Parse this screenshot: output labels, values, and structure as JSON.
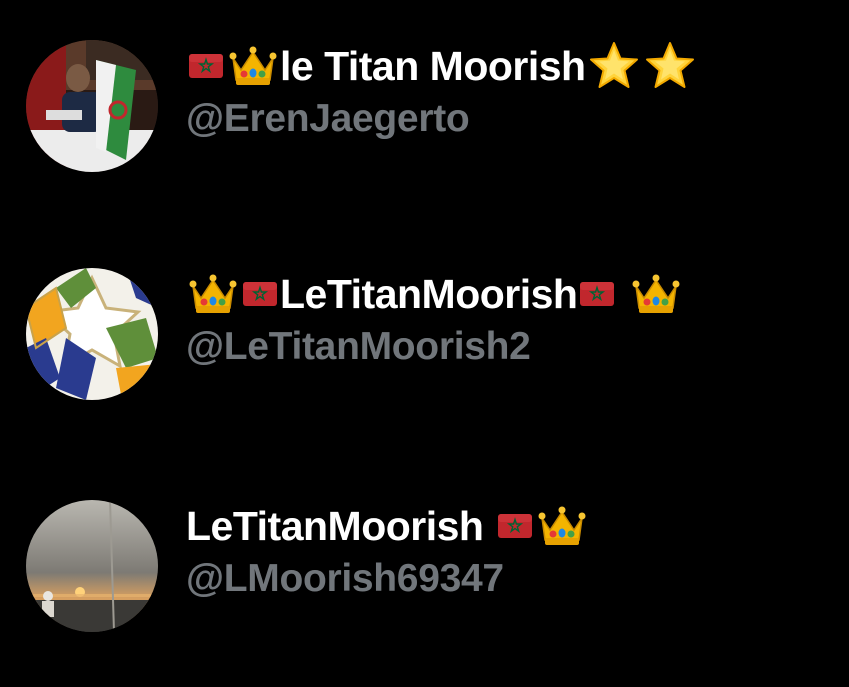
{
  "accounts": [
    {
      "display_name": "le Titan Moorish",
      "handle": "@ErenJaegerto",
      "prefix_emoji": [
        "morocco-flag",
        "crown"
      ],
      "suffix_emoji": [
        "star",
        "star"
      ]
    },
    {
      "display_name": "LeTitanMoorish",
      "handle": "@LeTitanMoorish2",
      "prefix_emoji": [
        "crown",
        "morocco-flag"
      ],
      "suffix_emoji": [
        "morocco-flag",
        "crown"
      ]
    },
    {
      "display_name": "LeTitanMoorish",
      "handle": "@LMoorish69347",
      "prefix_emoji": [],
      "suffix_emoji": [
        "morocco-flag",
        "crown"
      ]
    }
  ],
  "colors": {
    "background": "#000000",
    "name": "#ffffff",
    "handle": "#71767b",
    "flag_red": "#c1272d",
    "flag_star": "#006233",
    "crown_gold": "#f4b400"
  }
}
